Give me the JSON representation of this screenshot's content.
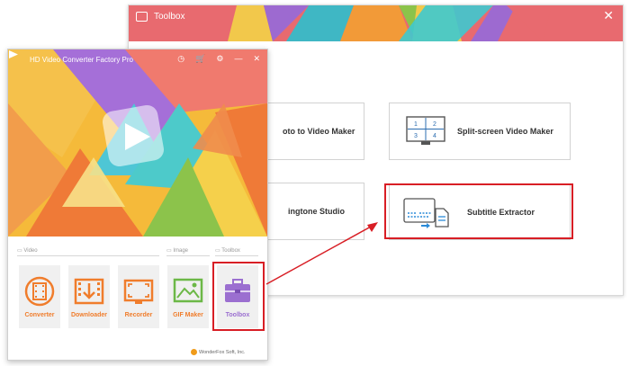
{
  "toolbox_window": {
    "title": "Toolbox",
    "close_glyph": "✕",
    "cards": [
      {
        "label": "oto to Video Maker",
        "icon": "photo-to-video-icon"
      },
      {
        "label": "Split-screen Video Maker",
        "icon": "split-screen-icon",
        "grid": [
          "1",
          "2",
          "3",
          "4"
        ]
      },
      {
        "label": "ingtone Studio",
        "icon": "ringtone-icon"
      },
      {
        "label": "Subtitle Extractor",
        "icon": "subtitle-extractor-icon"
      }
    ]
  },
  "main_window": {
    "title": "HD Video Converter Factory Pro",
    "title_icons": [
      "◷",
      "🛒",
      "⚙",
      "—",
      "✕"
    ],
    "sections": {
      "video": "Video",
      "image": "Image",
      "toolbox": "Toolbox"
    },
    "tiles": [
      {
        "label": "Converter",
        "icon": "film-reel-icon"
      },
      {
        "label": "Downloader",
        "icon": "download-icon"
      },
      {
        "label": "Recorder",
        "icon": "screen-record-icon"
      },
      {
        "label": "GIF Maker",
        "icon": "image-icon"
      },
      {
        "label": "Toolbox",
        "icon": "toolbox-icon"
      }
    ],
    "footer": "WonderFox Soft, Inc."
  },
  "colors": {
    "accent_orange": "#f07d2c",
    "accent_purple": "#9b6fd0",
    "highlight_red": "#d81e25",
    "title_red": "#e86a6f"
  }
}
